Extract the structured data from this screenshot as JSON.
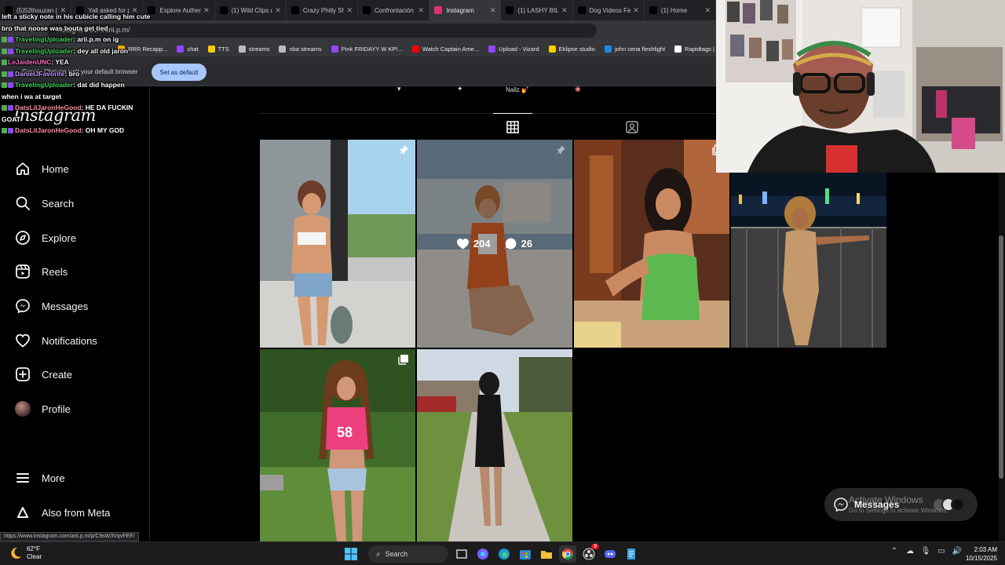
{
  "browser": {
    "tabs": [
      {
        "label": "(5)52thouzan (",
        "color": "#000"
      },
      {
        "label": "Yall asked for p",
        "color": "#000"
      },
      {
        "label": "Explore Authen",
        "color": "#000"
      },
      {
        "label": "(1) Wild Clips o",
        "color": "#000"
      },
      {
        "label": "Crazy Philly Sh",
        "color": "#000"
      },
      {
        "label": "Confrontación",
        "color": "#000"
      },
      {
        "label": "Instagram",
        "color": "#e1306c"
      },
      {
        "label": "(1) LASHY BILL",
        "color": "#000"
      },
      {
        "label": "Dog Videos Fe",
        "color": "#000"
      },
      {
        "label": "(1) Home",
        "color": "#000"
      }
    ],
    "url": "instagram.com/arii.p.m/",
    "bookmarks": [
      {
        "label": "RRR Recapp...",
        "color": "#f2a900"
      },
      {
        "label": "chat",
        "color": "#9146ff"
      },
      {
        "label": "TTS",
        "color": "#ffcc00"
      },
      {
        "label": "streams",
        "color": "#bbbbbb"
      },
      {
        "label": "nba streams",
        "color": "#bbbbbb"
      },
      {
        "label": "Pink FRIDAYY W KP!...",
        "color": "#9146ff"
      },
      {
        "label": "Watch Captain Ame...",
        "color": "#ff0000"
      },
      {
        "label": "Upload - Vizard",
        "color": "#9146ff"
      },
      {
        "label": "Eklipse studio",
        "color": "#ffcc00"
      },
      {
        "label": "john cena fleshlight",
        "color": "#1e88e5"
      },
      {
        "label": "Rapidtags | YouTu...",
        "color": "#ffffff"
      }
    ],
    "infobar_text": "Google Chrome isn't your default browser",
    "set_default_label": "Set as default",
    "status_url": "https://www.instagram.com/arii.p.m/p/C9sW3VqvFEF/"
  },
  "chat": [
    {
      "user": "",
      "message": "left a sticky note in his cubicle calling him cute",
      "color": "u-green",
      "badges": 0
    },
    {
      "user": "",
      "message": "bro that noose was bouta get tied",
      "color": "u-green",
      "badges": 0
    },
    {
      "user": "TravelingUploader",
      "message": "arii.p.m on ig",
      "color": "u-green",
      "badges": 2
    },
    {
      "user": "TravelingUploader",
      "message": "dey all old jaron",
      "color": "u-green",
      "badges": 2
    },
    {
      "user": "LeJaidenUNC",
      "message": "YEA",
      "color": "u-pink",
      "badges": 1
    },
    {
      "user": "DanielJFavorite",
      "message": "bro",
      "color": "u-purple",
      "badges": 2
    },
    {
      "user": "TravelingUploader",
      "message": "dat did happen",
      "color": "u-green",
      "badges": 2
    },
    {
      "user": "",
      "message": "when i wa at target",
      "color": "u-green",
      "badges": 0
    },
    {
      "user": "DatsLilJaronHeGood",
      "message": "HE DA FUCKIN",
      "color": "u-red",
      "badges": 2
    },
    {
      "user": "",
      "message": "GOAT",
      "color": "u-red",
      "badges": 0
    },
    {
      "user": "DatsLilJaronHeGood",
      "message": "OH MY GOD",
      "color": "u-red",
      "badges": 2
    }
  ],
  "instagram": {
    "logo": "Instagram",
    "nav": [
      {
        "label": "Home",
        "icon": "home-icon"
      },
      {
        "label": "Search",
        "icon": "search-icon"
      },
      {
        "label": "Explore",
        "icon": "explore-icon"
      },
      {
        "label": "Reels",
        "icon": "reels-icon"
      },
      {
        "label": "Messages",
        "icon": "messages-icon"
      },
      {
        "label": "Notifications",
        "icon": "heart-icon"
      },
      {
        "label": "Create",
        "icon": "create-icon"
      },
      {
        "label": "Profile",
        "icon": "avatar"
      }
    ],
    "more_label": "More",
    "meta_label": "Also from Meta",
    "highlight_label": "Nailz 💅",
    "post_likes": "204",
    "post_comments": "26",
    "messages_label": "Messages"
  },
  "windows_watermark": {
    "title": "Activate Windows",
    "subtitle": "Go to Settings to activate Windows."
  },
  "taskbar": {
    "temp": "62°F",
    "weather": "Clear",
    "search_label": "Search",
    "time": "2:03 AM",
    "date": "10/15/2025",
    "notif_badge": "9"
  }
}
